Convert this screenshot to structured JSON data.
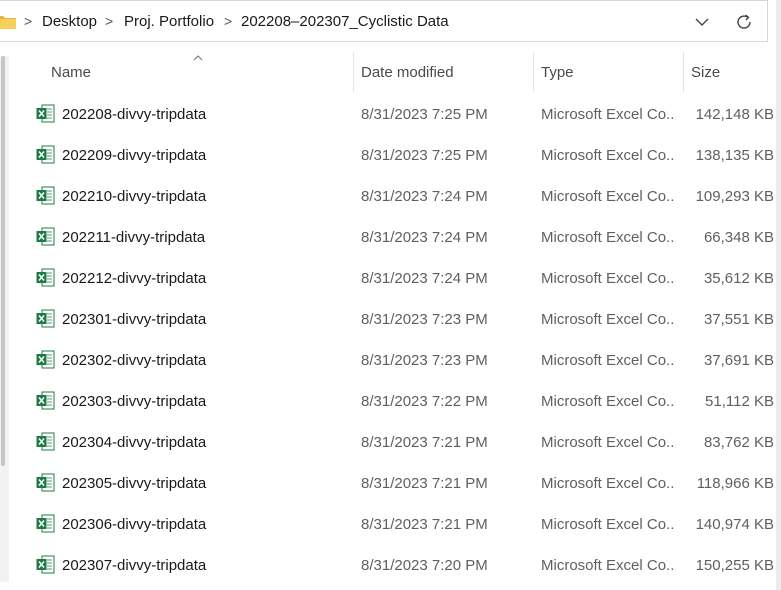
{
  "breadcrumb": {
    "items": [
      "Desktop",
      "Proj. Portfolio",
      "202208–202307_Cyclistic Data"
    ],
    "separator": ">"
  },
  "columns": {
    "name": "Name",
    "date": "Date modified",
    "type": "Type",
    "size": "Size"
  },
  "files": [
    {
      "name": "202208-divvy-tripdata",
      "date": "8/31/2023 7:25 PM",
      "type": "Microsoft Excel Co...",
      "size": "142,148 KB"
    },
    {
      "name": "202209-divvy-tripdata",
      "date": "8/31/2023 7:25 PM",
      "type": "Microsoft Excel Co...",
      "size": "138,135 KB"
    },
    {
      "name": "202210-divvy-tripdata",
      "date": "8/31/2023 7:24 PM",
      "type": "Microsoft Excel Co...",
      "size": "109,293 KB"
    },
    {
      "name": "202211-divvy-tripdata",
      "date": "8/31/2023 7:24 PM",
      "type": "Microsoft Excel Co...",
      "size": "66,348 KB"
    },
    {
      "name": "202212-divvy-tripdata",
      "date": "8/31/2023 7:24 PM",
      "type": "Microsoft Excel Co...",
      "size": "35,612 KB"
    },
    {
      "name": "202301-divvy-tripdata",
      "date": "8/31/2023 7:23 PM",
      "type": "Microsoft Excel Co...",
      "size": "37,551 KB"
    },
    {
      "name": "202302-divvy-tripdata",
      "date": "8/31/2023 7:23 PM",
      "type": "Microsoft Excel Co...",
      "size": "37,691 KB"
    },
    {
      "name": "202303-divvy-tripdata",
      "date": "8/31/2023 7:22 PM",
      "type": "Microsoft Excel Co...",
      "size": "51,112 KB"
    },
    {
      "name": "202304-divvy-tripdata",
      "date": "8/31/2023 7:21 PM",
      "type": "Microsoft Excel Co...",
      "size": "83,762 KB"
    },
    {
      "name": "202305-divvy-tripdata",
      "date": "8/31/2023 7:21 PM",
      "type": "Microsoft Excel Co...",
      "size": "118,966 KB"
    },
    {
      "name": "202306-divvy-tripdata",
      "date": "8/31/2023 7:21 PM",
      "type": "Microsoft Excel Co...",
      "size": "140,974 KB"
    },
    {
      "name": "202307-divvy-tripdata",
      "date": "8/31/2023 7:20 PM",
      "type": "Microsoft Excel Co...",
      "size": "150,255 KB"
    }
  ],
  "icons": {
    "folder": "folder-icon",
    "file": "excel-csv-file-icon",
    "dropdown": "chevron-down-icon",
    "refresh": "refresh-icon",
    "sort": "sort-ascending-caret-icon"
  },
  "colors": {
    "folder": "#f0c04a",
    "excel_green": "#1e7b45"
  }
}
